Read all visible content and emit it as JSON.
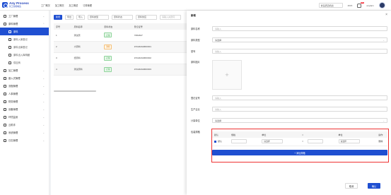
{
  "app": {
    "logo_title": "Any Process",
    "logo_sub": "智工智能制造",
    "top_nav": [
      "工厂概况",
      "加工概况",
      "加工概述",
      "订单管理"
    ],
    "company": "青岛研迈机加",
    "top_text": "4015",
    "badge": "99+",
    "username": "anylarm"
  },
  "sidebar": {
    "items": [
      {
        "label": "工厂管理",
        "type": "group"
      },
      {
        "label": "原料管理",
        "type": "group"
      },
      {
        "label": "原料",
        "type": "sub-active"
      },
      {
        "label": "原料入库登记",
        "type": "sub"
      },
      {
        "label": "原料出库登记",
        "type": "sub"
      },
      {
        "label": "原料出入库明细",
        "type": "sub"
      },
      {
        "label": "供应商",
        "type": "sub"
      },
      {
        "label": "加工管理",
        "type": "group"
      },
      {
        "label": "嵌入式管理",
        "type": "group"
      },
      {
        "label": "流程管理",
        "type": "group"
      },
      {
        "label": "人事管理",
        "type": "group"
      },
      {
        "label": "财务管理",
        "type": "group"
      },
      {
        "label": "设备管理",
        "type": "group"
      },
      {
        "label": "环境监测",
        "type": "group"
      },
      {
        "label": "云助手",
        "type": "group"
      },
      {
        "label": "系统管理",
        "type": "group"
      },
      {
        "label": "日志管理",
        "type": "group"
      }
    ]
  },
  "list": {
    "buttons": [
      "新增",
      "导出",
      "导入"
    ],
    "filter_type": "原料类型",
    "filter_status": "原料状态",
    "filter_supplier": "原料供应",
    "search_placeholder": "请输入关键词",
    "columns": [
      "序号",
      "原料名称",
      "原料状态",
      "登记证号"
    ],
    "rows": [
      {
        "no": "1",
        "name": "测试原",
        "status": "正常",
        "status_color": "green",
        "code": "768A847"
      },
      {
        "no": "2",
        "name": "大原料",
        "status": "暂停",
        "status_color": "orange",
        "code": "ZXGR20A8D0001"
      },
      {
        "no": "3",
        "name": "纸原料",
        "status": "正常",
        "status_color": "green",
        "code": "ZXGR20A8D0002"
      },
      {
        "no": "4",
        "name": "测试原料",
        "status": "正常",
        "status_color": "green",
        "code": "ZXGR20A8D0003"
      }
    ]
  },
  "drawer": {
    "title": "新增",
    "close": "×",
    "fields": [
      {
        "label": "原料名称",
        "placeholder": "请输入",
        "select": false
      },
      {
        "label": "原料类型",
        "placeholder": "请选择",
        "select": true
      },
      {
        "label": "型号",
        "placeholder": "请输入",
        "select": false
      },
      {
        "label": "原料图片",
        "placeholder": "",
        "select": false
      },
      {
        "label": "登记证号",
        "placeholder": "请输入",
        "select": false
      },
      {
        "label": "生产企业",
        "placeholder": "请输入",
        "select": false
      },
      {
        "label": "计量单位",
        "placeholder": "请选择",
        "select": true
      },
      {
        "label": "包装规格",
        "placeholder": "",
        "select": false
      }
    ],
    "upload_icon": "+",
    "spec_table": {
      "columns": [
        "默认",
        "规格",
        "单位",
        "=",
        "",
        "单位",
        "操作"
      ],
      "row": {
        "default": "默认",
        "spec": "",
        "unit": "请选择",
        "eq": "=",
        "value": "",
        "unit2": "请选择",
        "action": "删除"
      }
    },
    "add_spec_button": "+ 添加规格",
    "cancel": "取消",
    "confirm": "确认"
  },
  "colors": {
    "primary": "#1f4fd1",
    "highlight": "#e33333"
  }
}
